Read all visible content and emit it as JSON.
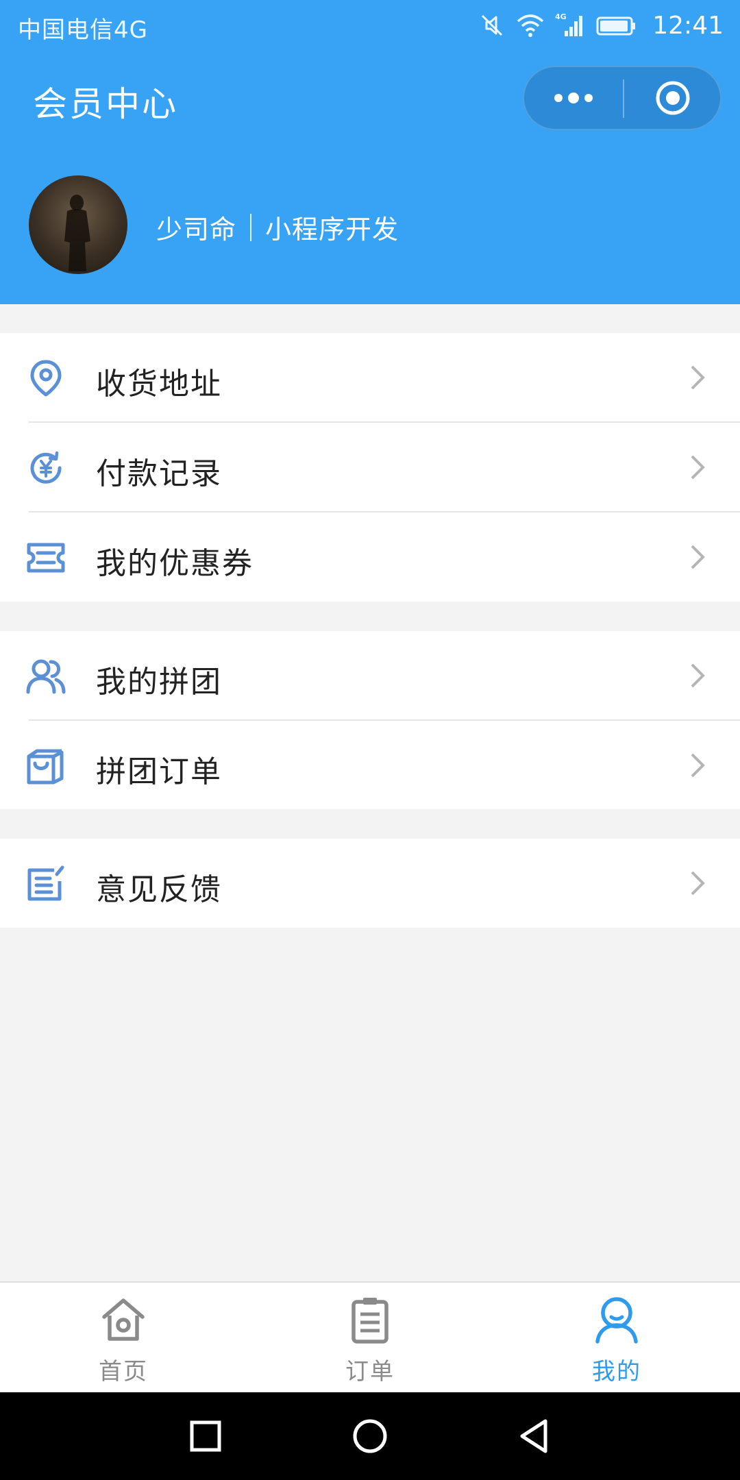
{
  "status_bar": {
    "carrier": "中国电信4G",
    "time": "12:41",
    "network_badge": "4G",
    "icons": [
      "mute-icon",
      "wifi-icon",
      "signal-icon",
      "battery-icon"
    ]
  },
  "nav": {
    "title": "会员中心",
    "more_icon": "more-dots-icon",
    "close_icon": "target-close-icon"
  },
  "profile": {
    "name": "少司命",
    "subtitle": "小程序开发"
  },
  "menu": {
    "group1": [
      {
        "label": "收货地址",
        "icon": "location-pin-icon"
      },
      {
        "label": "付款记录",
        "icon": "payment-yen-icon"
      },
      {
        "label": "我的优惠券",
        "icon": "coupon-ticket-icon"
      }
    ],
    "group2": [
      {
        "label": "我的拼团",
        "icon": "group-users-icon"
      },
      {
        "label": "拼团订单",
        "icon": "shopping-bag-icon"
      }
    ],
    "group3": [
      {
        "label": "意见反馈",
        "icon": "feedback-edit-icon"
      }
    ]
  },
  "tabbar": {
    "items": [
      {
        "label": "首页",
        "icon": "home-icon",
        "active": false
      },
      {
        "label": "订单",
        "icon": "clipboard-icon",
        "active": false
      },
      {
        "label": "我的",
        "icon": "user-icon",
        "active": true
      }
    ]
  },
  "colors": {
    "primary": "#38a3f5",
    "icon_blue": "#5b8fd6",
    "tab_active": "#2f9bef",
    "tab_inactive": "#8a8a8a",
    "background": "#f3f3f3"
  }
}
